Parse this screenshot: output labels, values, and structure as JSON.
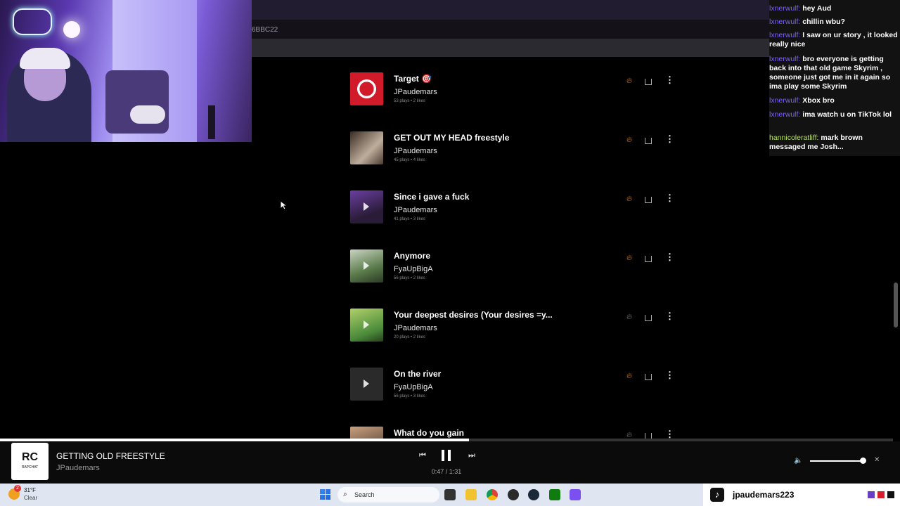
{
  "browser": {
    "url_fragment": "6BBC22"
  },
  "tracks": [
    {
      "title": "Target 🎯",
      "artist": "JPaudemars",
      "meta": "53 plays • 2 likes",
      "fire_active": true
    },
    {
      "title": "GET OUT MY HEAD freestyle",
      "artist": "JPaudemars",
      "meta": "45 plays • 4 likes",
      "fire_active": true
    },
    {
      "title": "Since i gave a fuck",
      "artist": "JPaudemars",
      "meta": "41 plays • 3 likes",
      "fire_active": true
    },
    {
      "title": "Anymore",
      "artist": "FyaUpBigA",
      "meta": "56 plays • 2 likes",
      "fire_active": true
    },
    {
      "title": "Your deepest desires (Your desires =y...",
      "artist": "JPaudemars",
      "meta": "20 plays • 2 likes",
      "fire_active": false
    },
    {
      "title": "On the river",
      "artist": "FyaUpBigA",
      "meta": "56 plays • 3 likes",
      "fire_active": true
    },
    {
      "title": "What do you gain",
      "artist": "",
      "meta": "",
      "fire_active": false
    }
  ],
  "chat": [
    {
      "user": "lxnerwulf:",
      "text": "hey Aud"
    },
    {
      "user": "lxnerwulf:",
      "text": "chillin wbu?"
    },
    {
      "user": "lxnerwulf:",
      "text": "I saw on ur story , it looked really nice"
    },
    {
      "user": "lxnerwulf:",
      "text": "bro everyone is getting back into that old game Skyrim , someone just got me in it again so ima play some Skyrim"
    },
    {
      "user": "lxnerwulf:",
      "text": "Xbox bro"
    },
    {
      "user": "lxnerwulf:",
      "text": "ima watch u on TikTok lol"
    },
    {
      "user": "hannicoleratliff:",
      "text": "mark brown messaged me Josh..."
    }
  ],
  "player": {
    "logo_text": "RC",
    "logo_sub": "RAPCHAT",
    "title": "GETTING OLD FREESTYLE",
    "artist": "JPaudemars",
    "time": "0:47 / 1:31",
    "progress_fraction": 0.525,
    "volume_fraction": 0.95
  },
  "taskbar": {
    "weather_badge": "2",
    "temperature": "31°F",
    "condition": "Clear",
    "search_placeholder": "Search",
    "tiktok_username": "jpaudemars223"
  },
  "colors": {
    "chat_user": "#7e5fff",
    "fire": "#e0761e",
    "taskbar": "#dfe6f1"
  }
}
